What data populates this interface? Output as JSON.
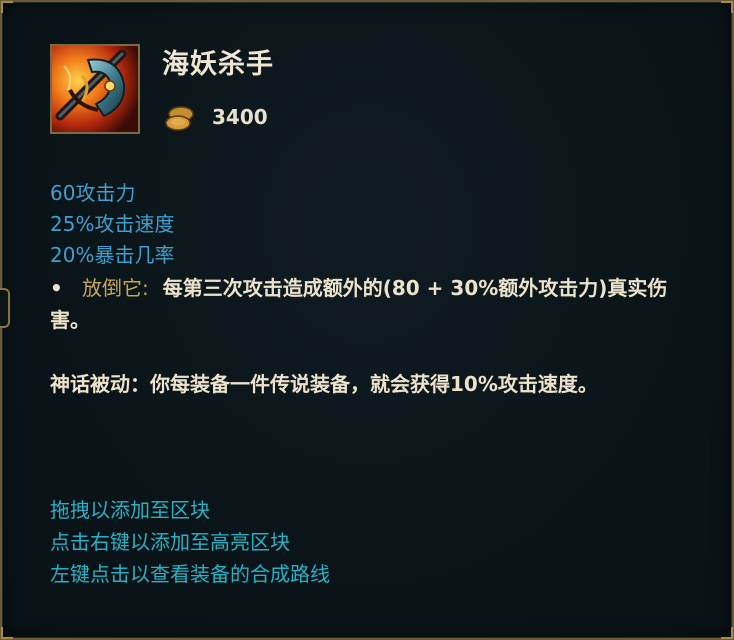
{
  "item": {
    "name": "海妖杀手",
    "price": "3400",
    "icon": "kraken-slayer-crossbow-icon"
  },
  "currency": {
    "icon": "gold-coin-icon"
  },
  "stats": [
    "60攻击力",
    "25%攻击速度",
    "20%暴击几率"
  ],
  "passive": {
    "bullet": "•",
    "name": "放倒它:",
    "description": "每第三次攻击造成额外的(80 + 30%额外攻击力)真实伤害。"
  },
  "mythic": {
    "text": "神话被动：你每装备一件传说装备，就会获得10%攻击速度。"
  },
  "hints": [
    "拖拽以添加至区块",
    "点击右键以添加至高亮区块",
    "左键点击以查看装备的合成路线"
  ],
  "colors": {
    "stat": "#3f9fcf",
    "passive_name": "#c8a55a",
    "hint": "#27b1c4",
    "body_text": "#ede3cc",
    "border": "#6a5a35"
  }
}
